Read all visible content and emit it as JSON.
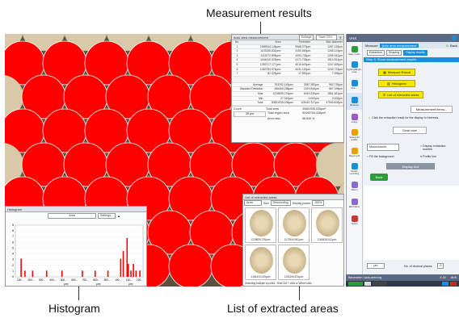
{
  "callouts": {
    "measurement_results": "Measurement results",
    "histogram": "Histogram",
    "list_of_extracted_areas": "List of extracted areas"
  },
  "results_window": {
    "title": "Auto area measurement",
    "enlarge": "Enlarge",
    "save_csv": "Save CSV...",
    "columns": [
      "No.",
      "Area",
      "Perimeter",
      "Max diameter"
    ],
    "rows": [
      [
        "1",
        "1559944.146µm²",
        "5968.079µm",
        "1287.135µm"
      ],
      [
        "2",
        "1103335.832µm²",
        "4150.663µm",
        "1268.124µm"
      ],
      [
        "3",
        "1113272.898µm²",
        "4494.745µm",
        "1265.442µm"
      ],
      [
        "4",
        "1164410.025µm²",
        "4171.706µm",
        "1514.814µm"
      ],
      [
        "5",
        "1059717.177µm²",
        "4015.603µm",
        "1247.826µm"
      ],
      [
        "6",
        "1082783.976µm²",
        "4031.153µm",
        "1240.723µm"
      ],
      [
        "7",
        "82.025µm²",
        "17.852µm",
        "7.396µm"
      ]
    ],
    "stats": [
      [
        "Average",
        "793292.145µm²",
        "3387.383µm",
        "962.739µm"
      ],
      [
        "Standard Deviation",
        "486460.288µm²",
        "1929.549µm",
        "567.196µm"
      ],
      [
        "Max",
        "1228839.276µm²",
        "6049.235µm",
        "1861.661µm"
      ],
      [
        "Min",
        "27.340µm²",
        "0.000µm",
        "0.000µm"
      ],
      [
        "Total",
        "30851935.035µm²",
        "125410.727µm",
        "37540.826µm"
      ]
    ],
    "count_label": "Count",
    "total_area_label": "Total area",
    "total_area_value": "30851935.035µm²",
    "px_value": "39 pcs",
    "total_region_label": "Total region area",
    "total_region_value": "52492784.436µm²",
    "area_ratio_label": "Area ratio",
    "area_ratio_value": "58.849 %"
  },
  "histogram_window": {
    "title": "Histogram",
    "dropdown": "Area",
    "settings": "Settings...",
    "x_ticks": [
      "100...",
      "200...",
      "300...",
      "400...",
      "500...",
      "600...",
      "700...",
      "800...",
      "900...",
      "100...",
      "110...",
      "120..."
    ],
    "y_ticks": [
      "9",
      "8",
      "7",
      "6",
      "5",
      "4",
      "3",
      "2",
      "1",
      "0"
    ],
    "unit_labels": [
      "µm²",
      "µm²",
      "µm²"
    ]
  },
  "list_window": {
    "title": "List of extracted areas",
    "sort_field": "Area",
    "sort_label": "Sort",
    "order": "Descending",
    "display_power_label": "Display power",
    "display_power": "100%",
    "items": [
      {
        "caption": "1228839.276µm²"
      },
      {
        "caption": "1172949.952µm²"
      },
      {
        "caption": "1160838.512µm²"
      },
      {
        "caption": "1164410.025µm²"
      },
      {
        "caption": "1153196.876µm²"
      }
    ],
    "footer": "Selecting multiple a points : Hold Ctrl + click or Wheel click"
  },
  "panel": {
    "app_name": "VHX",
    "header_tabs": [
      "Measure",
      "Auto area measurement"
    ],
    "back": "Back",
    "steps": [
      "Extraction",
      "Shaping",
      "Display results"
    ],
    "step_title": "Step 3: Show measurement results",
    "side_items": [
      "Easy mode",
      "Lighting/Bright-ness",
      "Mon...",
      "Measure",
      "Image",
      "Save/print quality",
      "Report pdf",
      "Result recording",
      "Album",
      "Edit Macro",
      "Option"
    ],
    "btn_measure_result": "Measure Result",
    "btn_histogram": "Histogram",
    "btn_list": "List of extracted areas",
    "btn_measure_items": "Measurement items...",
    "hint": "Click the extraction result for the display to interests.",
    "btn_grain": "Grain size",
    "monochrome": "Monochrome",
    "display_extraction": "Display extraction number",
    "fill_bg": "Fill the background",
    "profile_line": "Profile line",
    "display_tool": "Display tool",
    "back_btn": "Back",
    "um_unit": "µm",
    "decimal_places": "No. of decimal places:",
    "decimal_value": "0",
    "bottom_label": "Barometer / Auto-area ing",
    "bottom_zoom": "X 20",
    "bottom_auto": "AUX"
  },
  "colors": {
    "fill": "#ff0000",
    "accent": "#1a8fd8",
    "yellow": "#f5e800"
  }
}
